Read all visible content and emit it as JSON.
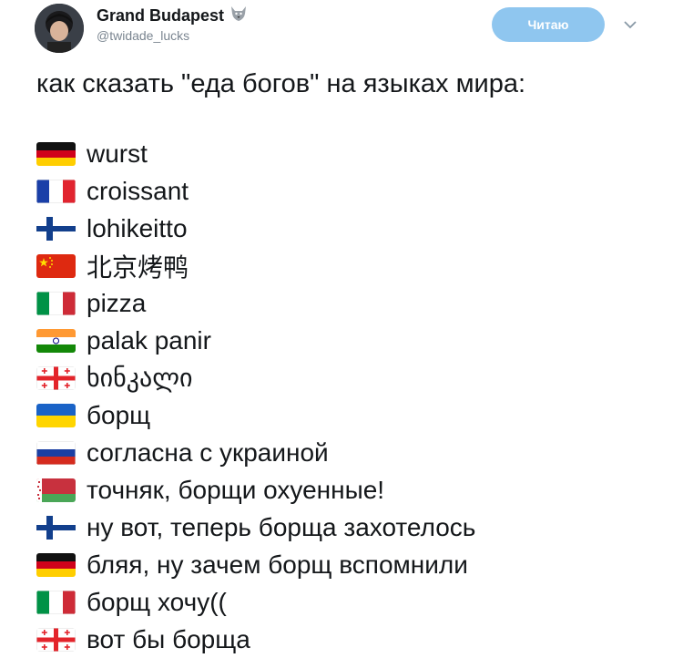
{
  "header": {
    "name": "Grand Budapest",
    "handle": "@twidade_lucks",
    "follow_label": "Читаю"
  },
  "tweet": {
    "text": "как сказать \"еда богов\" на языках мира:",
    "lines": [
      {
        "flag": "germany-flag",
        "text": "wurst"
      },
      {
        "flag": "france-flag",
        "text": "croissant"
      },
      {
        "flag": "finland-flag",
        "text": "lohikeitto"
      },
      {
        "flag": "china-flag",
        "text": "北京烤鸭"
      },
      {
        "flag": "italy-flag",
        "text": "pizza"
      },
      {
        "flag": "india-flag",
        "text": "palak panir"
      },
      {
        "flag": "georgia-flag",
        "text": "ხინკალი"
      },
      {
        "flag": "ukraine-flag",
        "text": "борщ"
      },
      {
        "flag": "russia-flag",
        "text": "согласна с украиной"
      },
      {
        "flag": "belarus-flag",
        "text": "точняк, борщи охуенные!"
      },
      {
        "flag": "finland-flag",
        "text": "ну вот, теперь борща захотелось"
      },
      {
        "flag": "germany-flag",
        "text": "бляя, ну зачем борщ вспомнили"
      },
      {
        "flag": "italy-flag",
        "text": "борщ хочу(("
      },
      {
        "flag": "georgia-flag",
        "text": "вот бы борща"
      }
    ]
  },
  "colors": {
    "follow_button": "#8fc6ef",
    "text": "#14171a",
    "handle": "#7a8590"
  }
}
